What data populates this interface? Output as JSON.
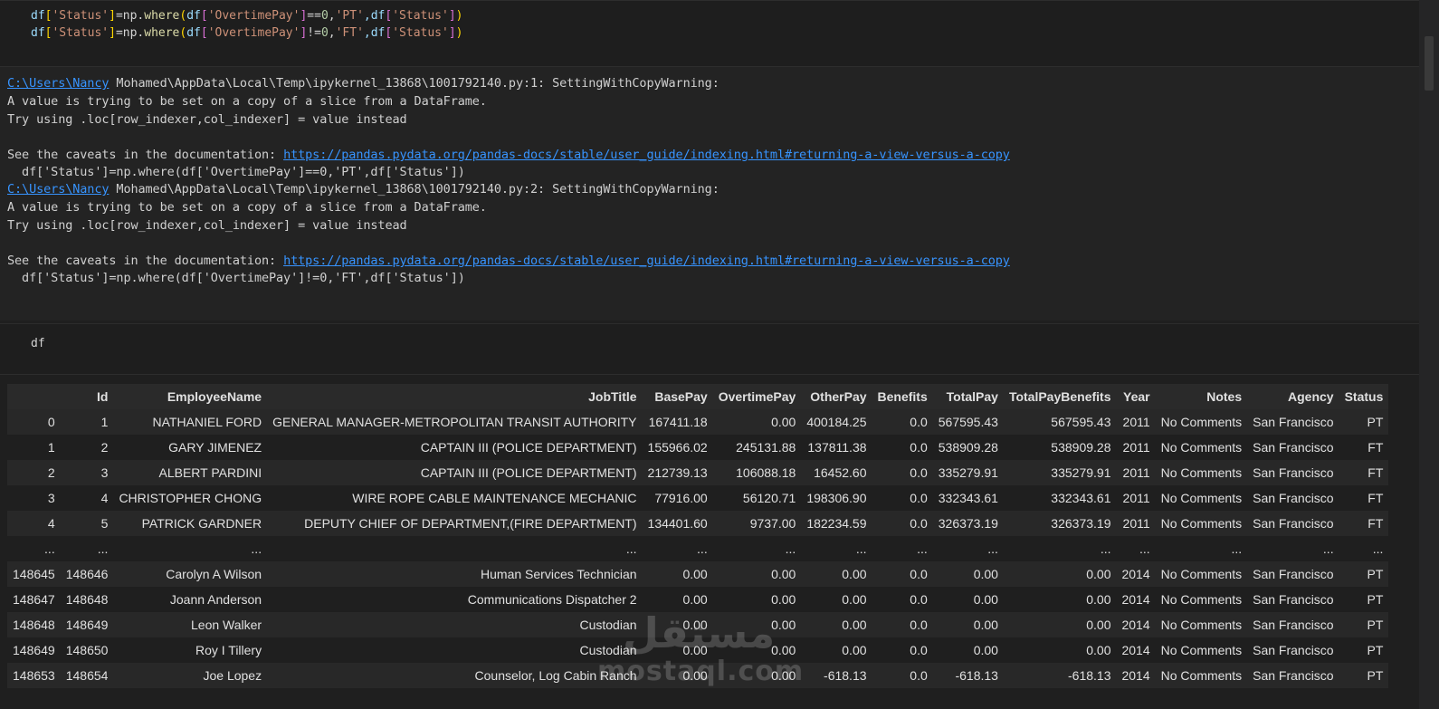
{
  "cell1": {
    "line1": {
      "a": "df",
      "b": "[",
      "c": "'Status'",
      "d": "]",
      "e": "=np.",
      "f": "where",
      "g": "(",
      "h": "df",
      "i": "[",
      "j": "'OvertimePay'",
      "k": "]",
      "l": "==",
      "m": "0",
      "n": ",",
      "o": "'PT'",
      "p": ",df",
      "q": "[",
      "r": "'Status'",
      "s": "]",
      "t": ")"
    },
    "line2": {
      "a": "df",
      "b": "[",
      "c": "'Status'",
      "d": "]",
      "e": "=np.",
      "f": "where",
      "g": "(",
      "h": "df",
      "i": "[",
      "j": "'OvertimePay'",
      "k": "]",
      "l": "!=",
      "m": "0",
      "n": ",",
      "o": "'FT'",
      "p": ",df",
      "q": "[",
      "r": "'Status'",
      "s": "]",
      "t": ")"
    }
  },
  "output": {
    "w1": {
      "link": "C:\\Users\\Nancy",
      "rest": " Mohamed\\AppData\\Local\\Temp\\ipykernel_13868\\1001792140.py:1: SettingWithCopyWarning:"
    },
    "w1_l2": "A value is trying to be set on a copy of a slice from a DataFrame.",
    "w1_l3": "Try using .loc[row_indexer,col_indexer] = value instead",
    "w1_l4": {
      "prefix": "See the caveats in the documentation: ",
      "link": "https://pandas.pydata.org/pandas-docs/stable/user_guide/indexing.html#returning-a-view-versus-a-copy"
    },
    "w1_l5": "  df['Status']=np.where(df['OvertimePay']==0,'PT',df['Status'])",
    "w2": {
      "link": "C:\\Users\\Nancy",
      "rest": " Mohamed\\AppData\\Local\\Temp\\ipykernel_13868\\1001792140.py:2: SettingWithCopyWarning:"
    },
    "w2_l2": "A value is trying to be set on a copy of a slice from a DataFrame.",
    "w2_l3": "Try using .loc[row_indexer,col_indexer] = value instead",
    "w2_l4": {
      "prefix": "See the caveats in the documentation: ",
      "link": "https://pandas.pydata.org/pandas-docs/stable/user_guide/indexing.html#returning-a-view-versus-a-copy"
    },
    "w2_l5": "  df['Status']=np.where(df['OvertimePay']!=0,'FT',df['Status'])"
  },
  "cell3": {
    "code": "df"
  },
  "table": {
    "columns": [
      "",
      "Id",
      "EmployeeName",
      "JobTitle",
      "BasePay",
      "OvertimePay",
      "OtherPay",
      "Benefits",
      "TotalPay",
      "TotalPayBenefits",
      "Year",
      "Notes",
      "Agency",
      "Status"
    ],
    "rows": [
      [
        "0",
        "1",
        "NATHANIEL FORD",
        "GENERAL MANAGER-METROPOLITAN TRANSIT AUTHORITY",
        "167411.18",
        "0.00",
        "400184.25",
        "0.0",
        "567595.43",
        "567595.43",
        "2011",
        "No Comments",
        "San Francisco",
        "PT"
      ],
      [
        "1",
        "2",
        "GARY JIMENEZ",
        "CAPTAIN III (POLICE DEPARTMENT)",
        "155966.02",
        "245131.88",
        "137811.38",
        "0.0",
        "538909.28",
        "538909.28",
        "2011",
        "No Comments",
        "San Francisco",
        "FT"
      ],
      [
        "2",
        "3",
        "ALBERT PARDINI",
        "CAPTAIN III (POLICE DEPARTMENT)",
        "212739.13",
        "106088.18",
        "16452.60",
        "0.0",
        "335279.91",
        "335279.91",
        "2011",
        "No Comments",
        "San Francisco",
        "FT"
      ],
      [
        "3",
        "4",
        "CHRISTOPHER CHONG",
        "WIRE ROPE CABLE MAINTENANCE MECHANIC",
        "77916.00",
        "56120.71",
        "198306.90",
        "0.0",
        "332343.61",
        "332343.61",
        "2011",
        "No Comments",
        "San Francisco",
        "FT"
      ],
      [
        "4",
        "5",
        "PATRICK GARDNER",
        "DEPUTY CHIEF OF DEPARTMENT,(FIRE DEPARTMENT)",
        "134401.60",
        "9737.00",
        "182234.59",
        "0.0",
        "326373.19",
        "326373.19",
        "2011",
        "No Comments",
        "San Francisco",
        "FT"
      ],
      [
        "...",
        "...",
        "...",
        "...",
        "...",
        "...",
        "...",
        "...",
        "...",
        "...",
        "...",
        "...",
        "...",
        "..."
      ],
      [
        "148645",
        "148646",
        "Carolyn A Wilson",
        "Human Services Technician",
        "0.00",
        "0.00",
        "0.00",
        "0.0",
        "0.00",
        "0.00",
        "2014",
        "No Comments",
        "San Francisco",
        "PT"
      ],
      [
        "148647",
        "148648",
        "Joann Anderson",
        "Communications Dispatcher 2",
        "0.00",
        "0.00",
        "0.00",
        "0.0",
        "0.00",
        "0.00",
        "2014",
        "No Comments",
        "San Francisco",
        "PT"
      ],
      [
        "148648",
        "148649",
        "Leon Walker",
        "Custodian",
        "0.00",
        "0.00",
        "0.00",
        "0.0",
        "0.00",
        "0.00",
        "2014",
        "No Comments",
        "San Francisco",
        "PT"
      ],
      [
        "148649",
        "148650",
        "Roy I Tillery",
        "Custodian",
        "0.00",
        "0.00",
        "0.00",
        "0.0",
        "0.00",
        "0.00",
        "2014",
        "No Comments",
        "San Francisco",
        "PT"
      ],
      [
        "148653",
        "148654",
        "Joe Lopez",
        "Counselor, Log Cabin Ranch",
        "0.00",
        "0.00",
        "-618.13",
        "0.0",
        "-618.13",
        "-618.13",
        "2014",
        "No Comments",
        "San Francisco",
        "PT"
      ]
    ]
  },
  "watermark": {
    "arabic": "مستقل",
    "latin": "mostaql.com"
  }
}
